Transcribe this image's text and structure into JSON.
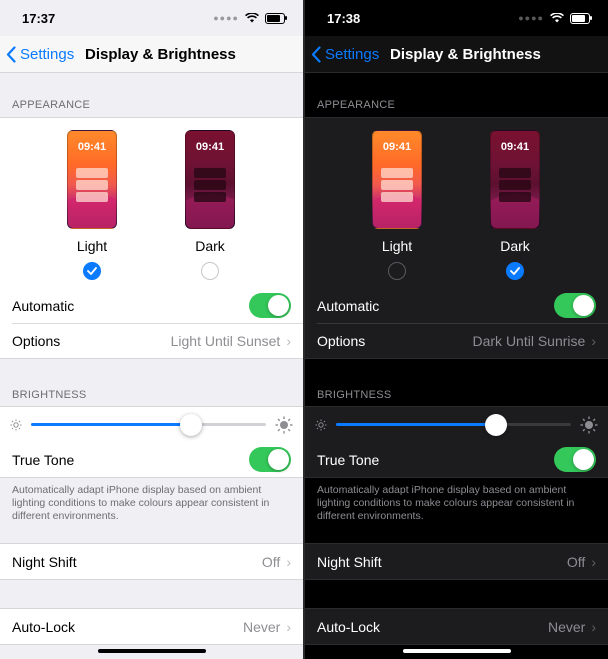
{
  "panes": [
    {
      "theme": "light",
      "status_time": "17:37",
      "nav": {
        "back_label": "Settings",
        "title": "Display & Brightness"
      },
      "appearance_header": "APPEARANCE",
      "light_option": {
        "label": "Light",
        "preview_time": "09:41",
        "selected": true
      },
      "dark_option": {
        "label": "Dark",
        "preview_time": "09:41",
        "selected": false
      },
      "automatic_label": "Automatic",
      "automatic_on": true,
      "options_label": "Options",
      "options_value": "Light Until Sunset",
      "brightness_header": "BRIGHTNESS",
      "brightness_level": 0.68,
      "true_tone_label": "True Tone",
      "true_tone_on": true,
      "true_tone_note": "Automatically adapt iPhone display based on ambient lighting conditions to make colours appear consistent in different environments.",
      "night_shift_label": "Night Shift",
      "night_shift_value": "Off",
      "auto_lock_label": "Auto-Lock",
      "auto_lock_value": "Never"
    },
    {
      "theme": "dark",
      "status_time": "17:38",
      "nav": {
        "back_label": "Settings",
        "title": "Display & Brightness"
      },
      "appearance_header": "APPEARANCE",
      "light_option": {
        "label": "Light",
        "preview_time": "09:41",
        "selected": false
      },
      "dark_option": {
        "label": "Dark",
        "preview_time": "09:41",
        "selected": true
      },
      "automatic_label": "Automatic",
      "automatic_on": true,
      "options_label": "Options",
      "options_value": "Dark Until Sunrise",
      "brightness_header": "BRIGHTNESS",
      "brightness_level": 0.68,
      "true_tone_label": "True Tone",
      "true_tone_on": true,
      "true_tone_note": "Automatically adapt iPhone display based on ambient lighting conditions to make colours appear consistent in different environments.",
      "night_shift_label": "Night Shift",
      "night_shift_value": "Off",
      "auto_lock_label": "Auto-Lock",
      "auto_lock_value": "Never"
    }
  ],
  "colors": {
    "accent": "#0a7aff",
    "toggle_on": "#34c759"
  },
  "icons": [
    "wifi-icon",
    "battery-icon",
    "chevron-left-icon",
    "chevron-right-icon",
    "checkmark-icon",
    "sun-small-icon",
    "sun-large-icon"
  ]
}
